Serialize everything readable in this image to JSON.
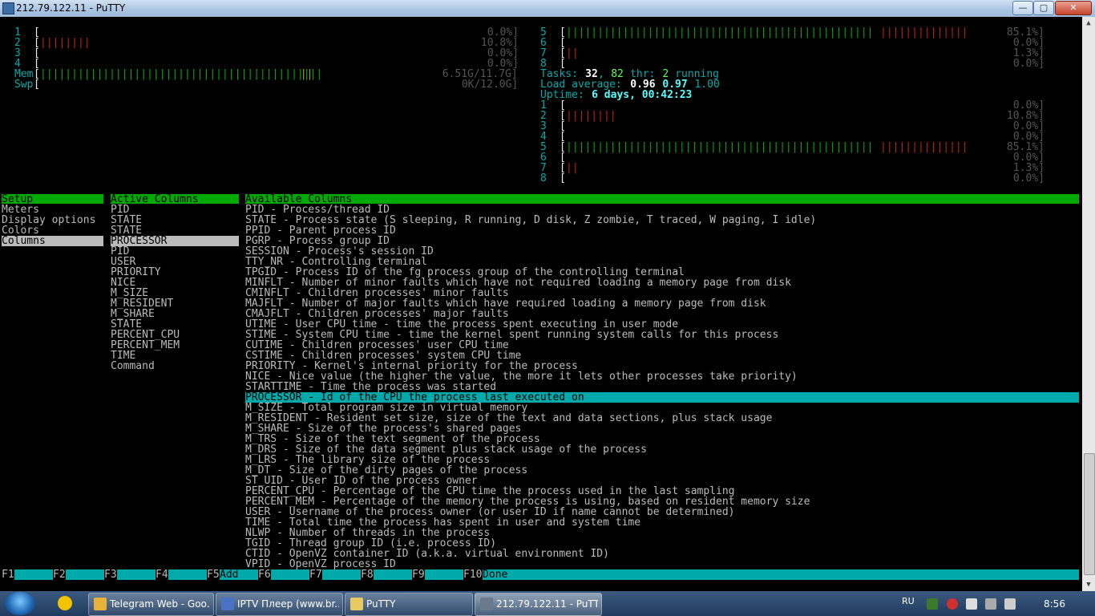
{
  "window": {
    "title": "212.79.122.11 - PuTTY",
    "min": "—",
    "max": "▢",
    "close": "✕"
  },
  "meters_left": [
    {
      "num": "1",
      "bar": "",
      "barClass": "red",
      "val": "0.0%]"
    },
    {
      "num": "2",
      "bar": "||||||||",
      "barClass": "red",
      "val": "10.8%]"
    },
    {
      "num": "3",
      "bar": "",
      "barClass": "red",
      "val": "0.0%]"
    },
    {
      "num": "4",
      "bar": "",
      "barClass": "red",
      "val": "0.0%]"
    }
  ],
  "mem": {
    "label": "Mem",
    "bar": "|||||||||||||||||||||||||||||||||||||||||||||",
    "bar2": "||",
    "val": "6.51G/11.7G]"
  },
  "swp": {
    "label": "Swp",
    "val": "0K/12.0G]"
  },
  "meters_right_top": [
    {
      "num": "5",
      "bar": "|||||||||||||||||||||||||||||||||||||||||||||||||",
      "bar2": "||||||||||||||",
      "val": "85.1%]"
    },
    {
      "num": "6",
      "bar": "",
      "bar2": "",
      "val": "0.0%]"
    },
    {
      "num": "7",
      "bar": "",
      "bar2": "||",
      "val": "1.3%]"
    },
    {
      "num": "8",
      "bar": "",
      "bar2": "",
      "val": "0.0%]"
    }
  ],
  "tasks": {
    "label": "Tasks: ",
    "a": "32",
    "sep": ", ",
    "b": "82",
    "thr": " thr: ",
    "c": "2",
    "run": " running"
  },
  "load": {
    "label": "Load average: ",
    "a": "0.96",
    "b": "0.97",
    "c": "1.00"
  },
  "uptime": {
    "label": "Uptime: ",
    "val": "6 days, 00:42:23"
  },
  "meters_right_bottom": [
    {
      "num": "1",
      "bar": "",
      "bar2": "",
      "val": "0.0%]"
    },
    {
      "num": "2",
      "bar": "",
      "bar2": "||||||||",
      "val": "10.8%]"
    },
    {
      "num": "3",
      "bar": "",
      "bar2": "",
      "val": "0.0%]"
    },
    {
      "num": "4",
      "bar": "",
      "bar2": "",
      "val": "0.0%]"
    },
    {
      "num": "5",
      "bar": "|||||||||||||||||||||||||||||||||||||||||||||||||",
      "bar2": "||||||||||||||",
      "val": "85.1%]"
    },
    {
      "num": "6",
      "bar": "",
      "bar2": "",
      "val": "0.0%]"
    },
    {
      "num": "7",
      "bar": "",
      "bar2": "||",
      "val": "1.3%]"
    },
    {
      "num": "8",
      "bar": "",
      "bar2": "",
      "val": "0.0%]"
    }
  ],
  "setup": {
    "header": "Setup",
    "items": [
      "Meters",
      "Display options",
      "Colors",
      "Columns"
    ],
    "selected": 3
  },
  "active": {
    "header": "Active Columns",
    "items": [
      "PID",
      "STATE",
      "STATE",
      "PROCESSOR",
      "PID",
      "USER",
      "PRIORITY",
      "NICE",
      "M_SIZE",
      "M_RESIDENT",
      "M_SHARE",
      "STATE",
      "PERCENT_CPU",
      "PERCENT_MEM",
      "TIME",
      "Command"
    ],
    "selected": 3
  },
  "available": {
    "header": "Available Columns",
    "items": [
      "PID - Process/thread ID",
      "STATE - Process state (S sleeping, R running, D disk, Z zombie, T traced, W paging, I idle)",
      "PPID - Parent process ID",
      "PGRP - Process group ID",
      "SESSION - Process's session ID",
      "TTY_NR - Controlling terminal",
      "TPGID - Process ID of the fg process group of the controlling terminal",
      "MINFLT - Number of minor faults which have not required loading a memory page from disk",
      "CMINFLT - Children processes' minor faults",
      "MAJFLT - Number of major faults which have required loading a memory page from disk",
      "CMAJFLT - Children processes' major faults",
      "UTIME - User CPU time - time the process spent executing in user mode",
      "STIME - System CPU time - time the kernel spent running system calls for this process",
      "CUTIME - Children processes' user CPU time",
      "CSTIME - Children processes' system CPU time",
      "PRIORITY - Kernel's internal priority for the process",
      "NICE - Nice value (the higher the value, the more it lets other processes take priority)",
      "STARTTIME - Time the process was started",
      "PROCESSOR - Id of the CPU the process last executed on",
      "M_SIZE - Total program size in virtual memory",
      "M_RESIDENT - Resident set size, size of the text and data sections, plus stack usage",
      "M_SHARE - Size of the process's shared pages",
      "M_TRS - Size of the text segment of the process",
      "M_DRS - Size of the data segment plus stack usage of the process",
      "M_LRS - The library size of the process",
      "M_DT - Size of the dirty pages of the process",
      "ST_UID - User ID of the process owner",
      "PERCENT_CPU - Percentage of the CPU time the process used in the last sampling",
      "PERCENT_MEM - Percentage of the memory the process is using, based on resident memory size",
      "USER - Username of the process owner (or user ID if name cannot be determined)",
      "TIME - Total time the process has spent in user and system time",
      "NLWP - Number of threads in the process",
      "TGID - Thread group ID (i.e. process ID)",
      "CTID - OpenVZ container ID (a.k.a. virtual environment ID)",
      "VPID - OpenVZ process ID"
    ],
    "selected": 18
  },
  "fkeys": [
    {
      "key": "F1",
      "label": ""
    },
    {
      "key": "F2",
      "label": ""
    },
    {
      "key": "F3",
      "label": ""
    },
    {
      "key": "F4",
      "label": ""
    },
    {
      "key": "F5",
      "label": "Add"
    },
    {
      "key": "F6",
      "label": ""
    },
    {
      "key": "F7",
      "label": ""
    },
    {
      "key": "F8",
      "label": ""
    },
    {
      "key": "F9",
      "label": ""
    },
    {
      "key": "F10",
      "label": "Done"
    }
  ],
  "taskbar": {
    "items": [
      {
        "label": "Telegram Web - Goo...",
        "icon": "chrome-icon",
        "color": "#e8b23a"
      },
      {
        "label": "IPTV Плеер (www.br...",
        "icon": "iptv-icon",
        "color": "#4a72c4"
      },
      {
        "label": "PuTTY",
        "icon": "folder-icon",
        "color": "#e8c860"
      },
      {
        "label": "212.79.122.11 - PuTTY",
        "icon": "putty-icon",
        "color": "#6a7a8a"
      }
    ],
    "lang": "RU",
    "clock": "8:56"
  }
}
